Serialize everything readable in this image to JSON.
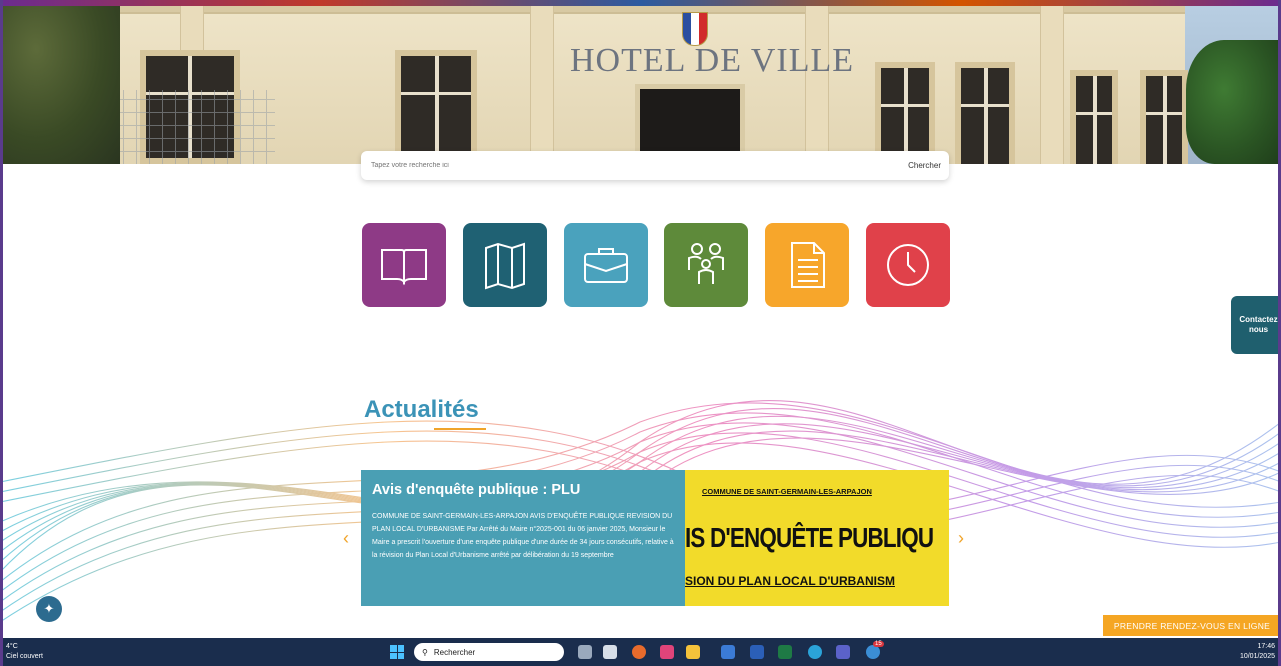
{
  "hero": {
    "building_sign": "HOTEL DE VILLE"
  },
  "search": {
    "placeholder": "Tapez votre recherche ici",
    "button_label": "Chercher"
  },
  "tiles": [
    {
      "icon": "book-icon",
      "color": "#8e3a86"
    },
    {
      "icon": "map-icon",
      "color": "#1f6173"
    },
    {
      "icon": "briefcase-icon",
      "color": "#4aa2bd"
    },
    {
      "icon": "family-icon",
      "color": "#5e8a3a"
    },
    {
      "icon": "document-icon",
      "color": "#f7a62b"
    },
    {
      "icon": "clock-icon",
      "color": "#e0414a"
    }
  ],
  "contact": {
    "label": "Contactez nous"
  },
  "news": {
    "title": "Actualités",
    "card": {
      "heading": "Avis d'enquête publique : PLU",
      "body": "COMMUNE DE SAINT-GERMAIN-LES-ARPAJON AVIS D'ENQUÊTE PUBLIQUE REVISION DU PLAN LOCAL D'URBANISME Par Arrêté du Maire n°2025-001 du 06 janvier 2025, Monsieur le Maire a prescrit l'ouverture d'une enquête publique d'une durée de 34 jours consécutifs, relative à la révision du Plan Local d'Urbanisme arrêté par délibération du 19 septembre",
      "image_line1": "COMMUNE DE SAINT-GERMAIN-LES-ARPAJON",
      "image_line2": "IS D'ENQUÊTE PUBLIQU",
      "image_line3": "SION DU PLAN LOCAL D'URBANISM"
    },
    "prev_arrow": "‹",
    "next_arrow": "›"
  },
  "rdv_button": "PRENDRE RENDEZ-VOUS EN LIGNE",
  "taskbar": {
    "weather_temp": "4°C",
    "weather_desc": "Ciel couvert",
    "search_label": "Rechercher",
    "time": "17:46",
    "date": "10/01/2025",
    "notification_count": "15"
  }
}
